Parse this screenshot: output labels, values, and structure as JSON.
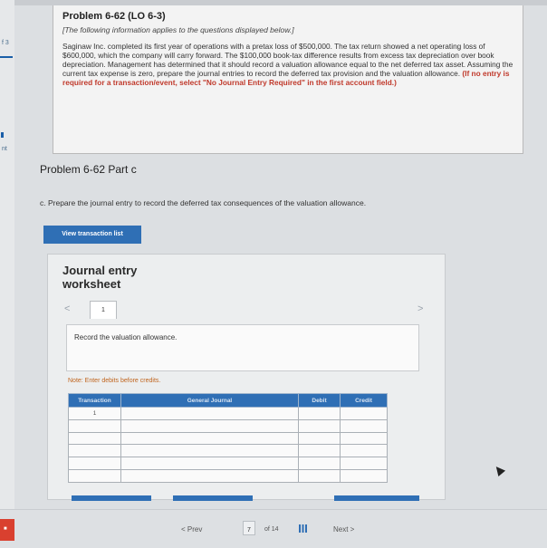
{
  "sidebar_fragments": [
    "f 3",
    "nt"
  ],
  "problem": {
    "title": "Problem 6-62 (LO 6-3)",
    "note": "[The following information applies to the questions displayed below.]",
    "body": "Saginaw Inc. completed its first year of operations with a pretax loss of $500,000. The tax return showed a net operating loss of $600,000, which the company will carry forward. The $100,000 book-tax difference results from excess tax depreciation over book depreciation. Management has determined that it should record a valuation allowance equal to the net deferred tax asset. Assuming the current tax expense is zero, prepare the journal entries to record the deferred tax provision and the valuation allowance.",
    "instruction": "(If no entry is required for a transaction/event, select \"No Journal Entry Required\" in the first account field.)"
  },
  "part": {
    "title": "Problem 6-62 Part c",
    "question": "c. Prepare the journal entry to record the deferred tax consequences of the valuation allowance."
  },
  "view_transaction_list": "View transaction list",
  "worksheet": {
    "title": "Journal entry worksheet",
    "nav_prev": "<",
    "nav_next": ">",
    "tab": "1",
    "record_text": "Record the valuation allowance.",
    "note": "Note: Enter debits before credits.",
    "columns": [
      "Transaction",
      "General Journal",
      "Debit",
      "Credit"
    ],
    "rows": [
      [
        "1",
        "",
        "",
        ""
      ],
      [
        "",
        "",
        "",
        ""
      ],
      [
        "",
        "",
        "",
        ""
      ],
      [
        "",
        "",
        "",
        ""
      ],
      [
        "",
        "",
        "",
        ""
      ],
      [
        "",
        "",
        "",
        ""
      ]
    ]
  },
  "footer": {
    "prev": "< Prev",
    "page_current": "7",
    "page_of": "of 14",
    "next": "Next >"
  },
  "colors": {
    "accent": "#2f6fb5",
    "instruction_red": "#c0392b",
    "note_orange": "#c0641d"
  }
}
